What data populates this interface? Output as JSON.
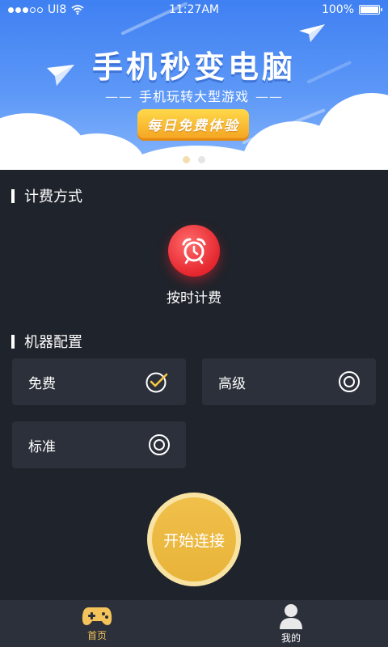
{
  "status_bar": {
    "carrier": "UI8",
    "time": "11:27AM",
    "battery": "100%",
    "battery_level": 1.0,
    "signal_bars_filled": 3,
    "signal_bars_total": 5
  },
  "banner": {
    "title": "手机秒变电脑",
    "subtitle": "手机玩转大型游戏",
    "subtitle_dash": "——",
    "promo_button": "每日免费体验",
    "carousel_pages": 2,
    "carousel_active_index": 0
  },
  "billing": {
    "section_title": "计费方式",
    "mode_icon": "alarm-clock-icon",
    "mode_label": "按时计费"
  },
  "machine_config": {
    "section_title": "机器配置",
    "options": [
      {
        "label": "免费",
        "selected": true
      },
      {
        "label": "高级",
        "selected": false
      },
      {
        "label": "标准",
        "selected": false
      }
    ]
  },
  "start_button": {
    "label": "开始连接"
  },
  "bottom_nav": [
    {
      "label": "首页",
      "icon": "gamepad-icon",
      "active": true
    },
    {
      "label": "我的",
      "icon": "user-icon",
      "active": false
    }
  ],
  "colors": {
    "background": "#1f232b",
    "card": "#2b303a",
    "banner_blue": "#3f80f2",
    "accent_gold": "#f4c35a",
    "alarm_red": "#e5262e",
    "check_gold": "#f5c842"
  }
}
